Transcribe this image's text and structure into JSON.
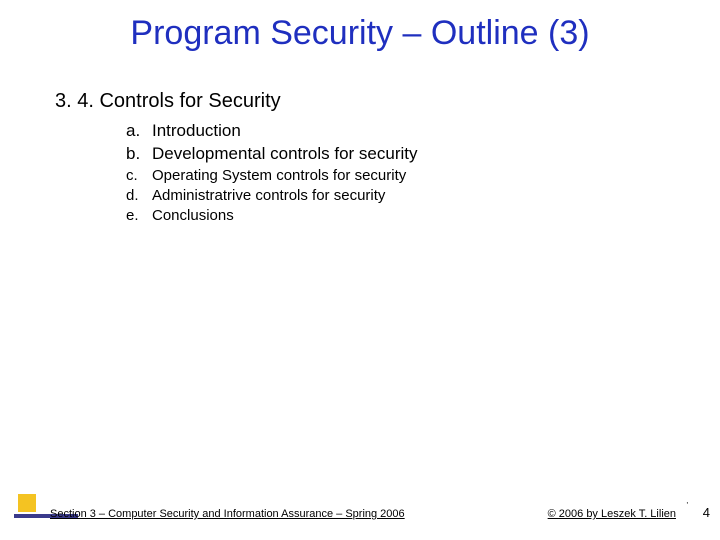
{
  "title": "Program Security – Outline (3)",
  "section": "3. 4. Controls for Security",
  "items": [
    {
      "marker": "a.",
      "text": "Introduction",
      "small": false
    },
    {
      "marker": "b.",
      "text": "Developmental controls for security",
      "small": false
    },
    {
      "marker": "c.",
      "text": "Operating System controls for security",
      "small": true
    },
    {
      "marker": "d.",
      "text": "Administratrive controls for security",
      "small": true
    },
    {
      "marker": "e.",
      "text": "Conclusions",
      "small": true
    }
  ],
  "footer": {
    "left": "Section 3 – Computer Security and Information Assurance – Spring 2006",
    "right": "© 2006 by Leszek T. Lilien"
  },
  "page_number": "4",
  "tick": "'"
}
